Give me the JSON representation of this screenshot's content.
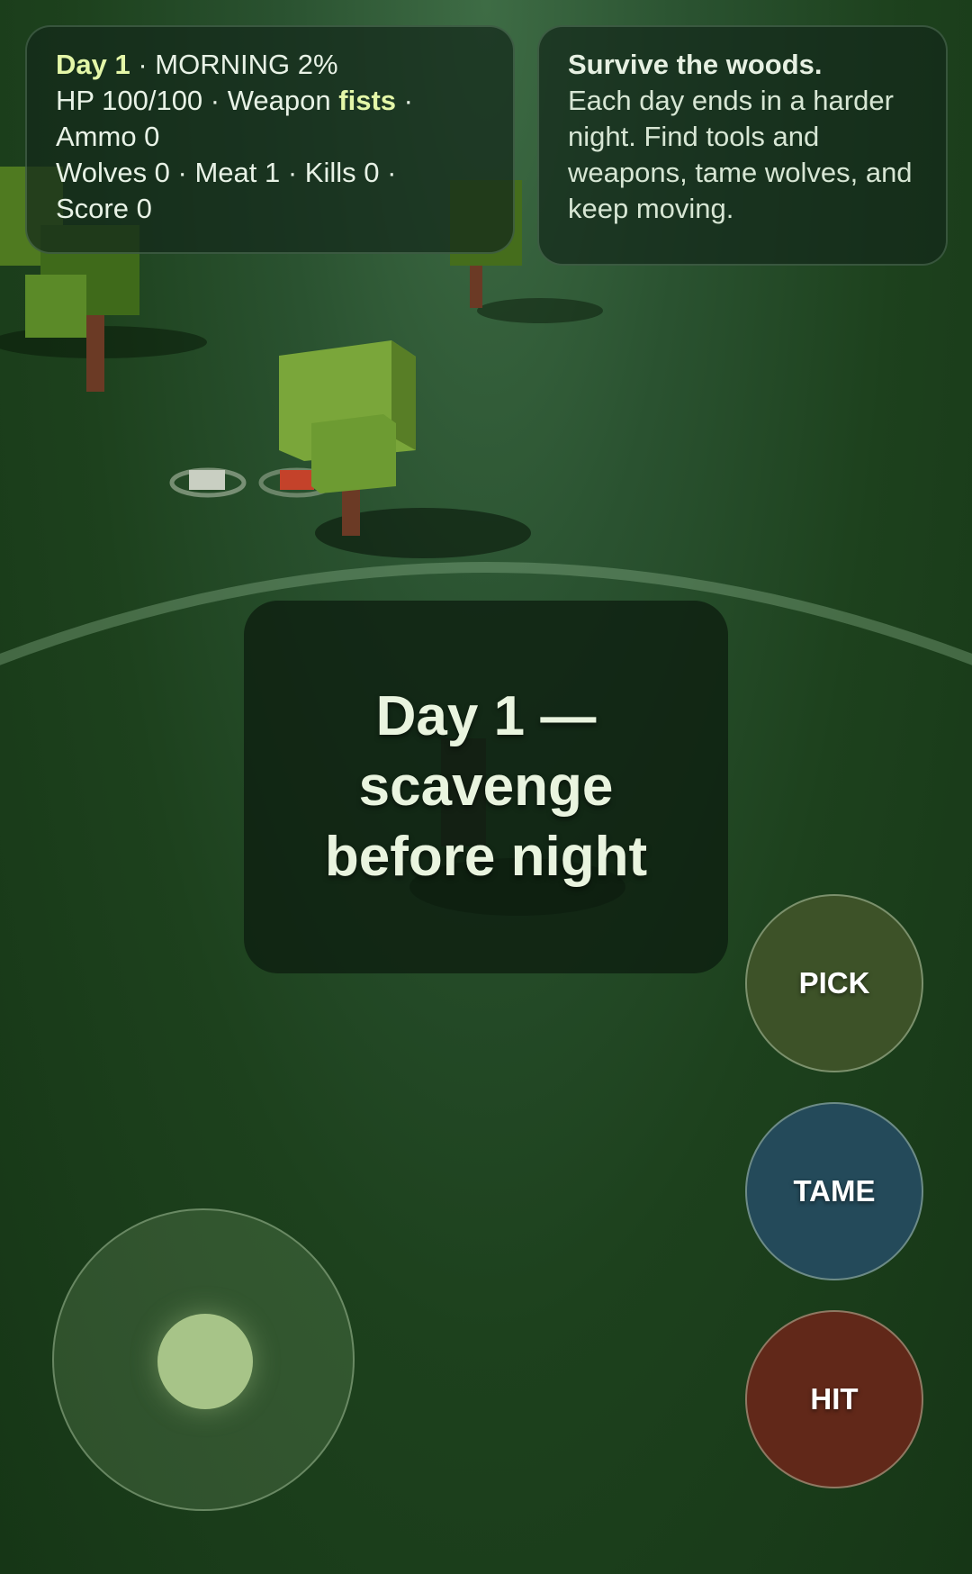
{
  "hud": {
    "day_label": "Day 1",
    "phase": "· MORNING 2%",
    "hp_label": "HP 100/100 · Weapon",
    "weapon": "fists",
    "weapon_sep": "·",
    "ammo": "Ammo 0",
    "wolves_meat_kills": "Wolves 0 · Meat 1 · Kills 0 ·",
    "score": "Score 0"
  },
  "hint": {
    "title": "Survive the woods.",
    "body": "Each day ends in a harder night. Find tools and weapons, tame wolves, and keep moving."
  },
  "banner": {
    "text": "Day 1 — scavenge before night"
  },
  "controls": {
    "pick_label": "PICK",
    "tame_label": "TAME",
    "hit_label": "HIT"
  },
  "colors": {
    "ground": "#1d411d",
    "accent_text": "#e4f7a8",
    "pick": "#3d5228",
    "tame": "#244a5a",
    "hit": "#612819",
    "joystick_knob": "#a7c488"
  }
}
